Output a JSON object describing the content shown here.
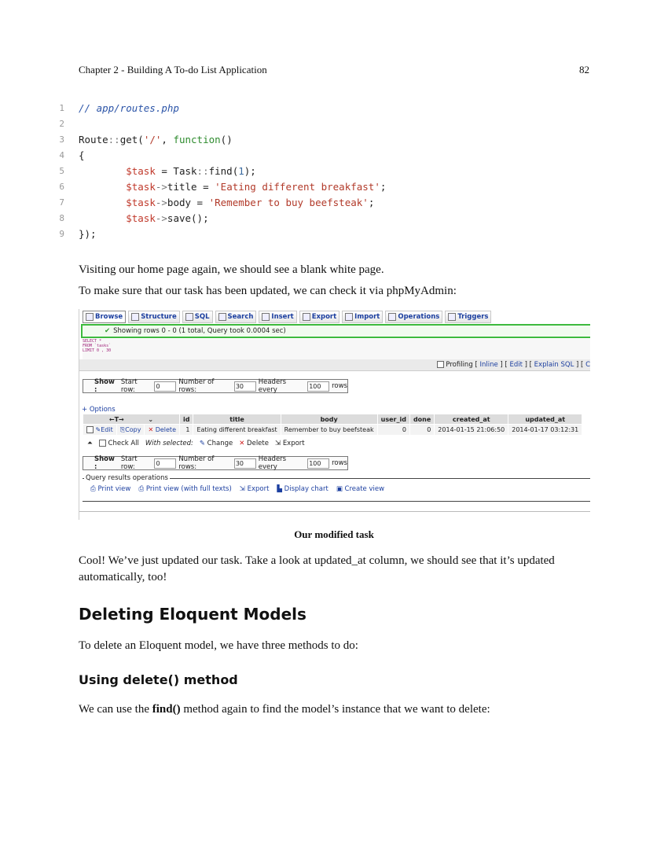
{
  "header": {
    "chapter": "Chapter 2 - Building A To-do List Application",
    "page_number": "82"
  },
  "code": {
    "lines": [
      {
        "n": "1",
        "html": "<span class='c-com'>// app/routes.php</span>"
      },
      {
        "n": "2",
        "html": ""
      },
      {
        "n": "3",
        "html": "Route<span class='c-op'>::</span>get(<span class='c-str'>'/'</span>, <span class='c-kw'>function</span>()"
      },
      {
        "n": "4",
        "html": "{"
      },
      {
        "n": "5",
        "html": "        <span class='c-var'>$task</span> = Task<span class='c-op'>::</span>find(<span class='c-num'>1</span>);"
      },
      {
        "n": "6",
        "html": "        <span class='c-var'>$task</span><span class='c-op'>-&gt;</span>title = <span class='c-str'>'Eating different breakfast'</span>;"
      },
      {
        "n": "7",
        "html": "        <span class='c-var'>$task</span><span class='c-op'>-&gt;</span>body = <span class='c-str'>'Remember to buy beefsteak'</span>;"
      },
      {
        "n": "8",
        "html": "        <span class='c-var'>$task</span><span class='c-op'>-&gt;</span>save();"
      },
      {
        "n": "9",
        "html": "});"
      }
    ]
  },
  "para1": "Visiting our home page again, we should see a blank white page.",
  "para2": "To make sure that our task has been updated, we can check it via phpMyAdmin:",
  "pma": {
    "tabs": [
      "Browse",
      "Structure",
      "SQL",
      "Search",
      "Insert",
      "Export",
      "Import",
      "Operations",
      "Triggers"
    ],
    "success": "Showing rows 0 - 0 (1 total, Query took 0.0004 sec)",
    "sql_lines": [
      "SELECT *",
      "FROM `tasks`",
      "LIMIT 0 , 30"
    ],
    "profiling": "Profiling",
    "prof_links": [
      "Inline",
      "Edit",
      "Explain SQL",
      "C"
    ],
    "show_label": "Show :",
    "start_row_label": "Start row:",
    "start_row_value": "0",
    "num_rows_label": "Number of rows:",
    "num_rows_value": "30",
    "headers_every_label": "Headers every",
    "headers_every_value": "100",
    "rows_label": "rows",
    "options": "+ Options",
    "arrows": "←T→",
    "columns": [
      "id",
      "title",
      "body",
      "user_id",
      "done",
      "created_at",
      "updated_at"
    ],
    "row": {
      "edit": "Edit",
      "copy": "Copy",
      "delete": "Delete",
      "id": "1",
      "title": "Eating different breakfast",
      "body": "Remember to buy beefsteak",
      "user_id": "0",
      "done": "0",
      "created_at": "2014-01-15 21:06:50",
      "updated_at": "2014-01-17 03:12:31"
    },
    "check_all": "Check All",
    "with_selected": "With selected:",
    "bulk": [
      "Change",
      "Delete",
      "Export"
    ],
    "qro_legend": "Query results operations",
    "qro_links": [
      "Print view",
      "Print view (with full texts)",
      "Export",
      "Display chart",
      "Create view"
    ]
  },
  "caption": "Our modified task",
  "para3": "Cool! We’ve just updated our task. Take a look at updated_at column, we should see that it’s updated automatically, too!",
  "h2": "Deleting Eloquent Models",
  "para4": "To delete an Eloquent model, we have three methods to do:",
  "h3": "Using delete() method",
  "para5_a": "We can use the ",
  "para5_b": "find()",
  "para5_c": " method again to find the model’s instance that we want to delete:"
}
